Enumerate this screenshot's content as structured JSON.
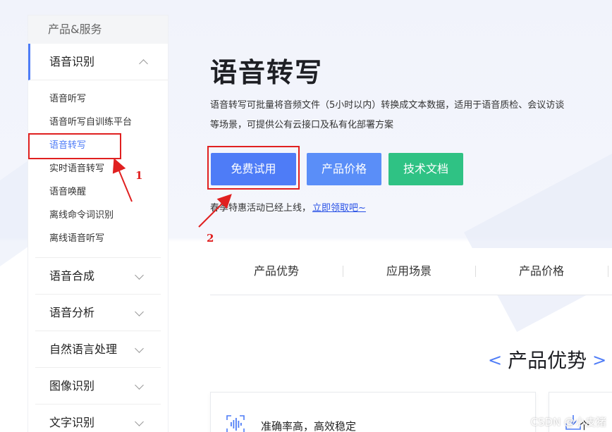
{
  "sidebar": {
    "header": "产品&服务",
    "categories": [
      {
        "label": "语音识别"
      },
      {
        "label": "语音合成"
      },
      {
        "label": "语音分析"
      },
      {
        "label": "自然语言处理"
      },
      {
        "label": "图像识别"
      },
      {
        "label": "文字识别"
      }
    ],
    "subitems": [
      {
        "label": "语音听写"
      },
      {
        "label": "语音听写自训练平台"
      },
      {
        "label": "语音转写"
      },
      {
        "label": "实时语音转写"
      },
      {
        "label": "语音唤醒"
      },
      {
        "label": "离线命令词识别"
      },
      {
        "label": "离线语音听写"
      }
    ],
    "active_subitem": "语音转写"
  },
  "main": {
    "title": "语音转写",
    "description": "语音转写可批量将音频文件（5小时以内）转换成文本数据，适用于语音质检、会议访谈等场景，可提供公有云接口及私有化部署方案",
    "buttons": {
      "trial": "免费试用",
      "price": "产品价格",
      "docs": "技术文档"
    },
    "promo": {
      "text": "春季特惠活动已经上线，",
      "link": "立即领取吧~"
    },
    "tabs": [
      "产品优势",
      "应用场景",
      "产品价格"
    ],
    "section_title": "产品优势",
    "section_arrow_left": "<",
    "section_arrow_right": ">",
    "card1_title": "准确率高，高效稳定",
    "card2_text": "个"
  },
  "annotations": {
    "num1": "1",
    "num2": "2"
  },
  "watermark": "CSDN @小皮猪",
  "colors": {
    "primary": "#4e7cf7",
    "price_button": "#5a8ef8",
    "docs_button": "#2fc284",
    "annotation": "#e02020",
    "link": "#2851e6"
  },
  "icons": {
    "card1": "waveform-scan-icon",
    "card2": "download-icon",
    "expand": "chevron-up-icon",
    "collapse": "chevron-down-icon"
  }
}
